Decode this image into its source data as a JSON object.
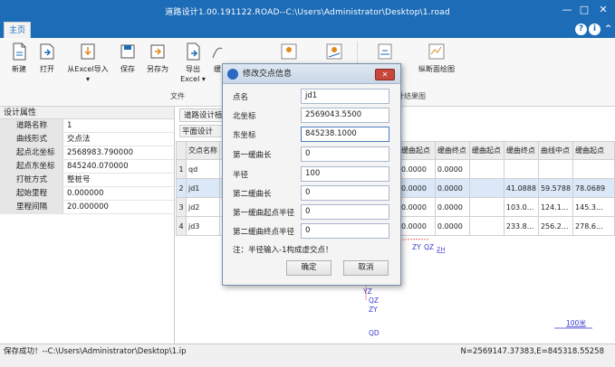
{
  "window": {
    "title": "道路设计1.00.191122.ROAD--C:\\Users\\Administrator\\Desktop\\1.road",
    "minimize": "—",
    "maximize": "□",
    "close": "✕"
  },
  "tabs": {
    "home": "主页",
    "help": "?",
    "info": "i",
    "collapse": "^"
  },
  "ribbon": {
    "buttons": [
      "新建",
      "打开",
      "从Excel导入",
      "保存",
      "另存为",
      "导出",
      "Excel",
      "缓",
      "纵断面绘图"
    ],
    "groups": [
      "文件",
      "计结果图"
    ]
  },
  "left_panel": {
    "title": "设计属性",
    "rows": [
      {
        "key": "道路名称",
        "value": "1"
      },
      {
        "key": "曲线形式",
        "value": "交点法"
      },
      {
        "key": "起点北坐标",
        "value": "2568983.790000"
      },
      {
        "key": "起点东坐标",
        "value": "845240.070000"
      },
      {
        "key": "打桩方式",
        "value": "整桩号"
      },
      {
        "key": "起始里程",
        "value": "0.000000"
      },
      {
        "key": "里程间隔",
        "value": "20.000000"
      }
    ]
  },
  "doc": {
    "tab": "道路设计植",
    "subtab": "平面设计",
    "columns": [
      "",
      "交点名称",
      "",
      "缓曲起点",
      "缓曲终点",
      "缓曲起点",
      "缓曲终点",
      "曲线中点",
      "缓曲起点"
    ],
    "rows": [
      {
        "n": "1",
        "name": "qd",
        "c2": "",
        "c3": "0.0000",
        "c4": "0.0000",
        "c5": "",
        "c6": "",
        "c7": "",
        "c8": ""
      },
      {
        "n": "2",
        "name": "jd1",
        "c2": "",
        "c3": "0.0000",
        "c4": "0.0000",
        "c5": "",
        "c6": "41.0888",
        "c7": "59.5788",
        "c8": "78.0689"
      },
      {
        "n": "3",
        "name": "jd2",
        "c2": "",
        "c3": "0.0000",
        "c4": "0.0000",
        "c5": "",
        "c6": "103.0...",
        "c7": "124.1...",
        "c8": "145.3..."
      },
      {
        "n": "4",
        "name": "jd3",
        "c2": "",
        "c3": "0.0000",
        "c4": "0.0000",
        "c5": "",
        "c6": "233.8...",
        "c7": "256.2...",
        "c8": "278.6..."
      }
    ]
  },
  "plot": {
    "labels": [
      "ZY",
      "QZ",
      "YZ",
      "QZ",
      "ZY",
      "QD",
      "ZH"
    ],
    "scale": "100米"
  },
  "status": {
    "left": "保存成功！--C:\\Users\\Administrator\\Desktop\\1.ip",
    "right": "N=2569147.37383,E=845318.55258"
  },
  "dialog": {
    "title": "修改交点信息",
    "close": "✕",
    "fields": [
      {
        "label": "点名",
        "value": "jd1"
      },
      {
        "label": "北坐标",
        "value": "2569043.5500"
      },
      {
        "label": "东坐标",
        "value": "845238.1000"
      },
      {
        "label": "第一缓曲长",
        "value": "0"
      },
      {
        "label": "半径",
        "value": "100"
      },
      {
        "label": "第二缓曲长",
        "value": "0"
      },
      {
        "label": "第一缓曲起点半径",
        "value": "0"
      },
      {
        "label": "第二缓曲终点半径",
        "value": "0"
      }
    ],
    "note": "注：半径输入-1构成虚交点！",
    "ok": "确定",
    "cancel": "取消"
  }
}
